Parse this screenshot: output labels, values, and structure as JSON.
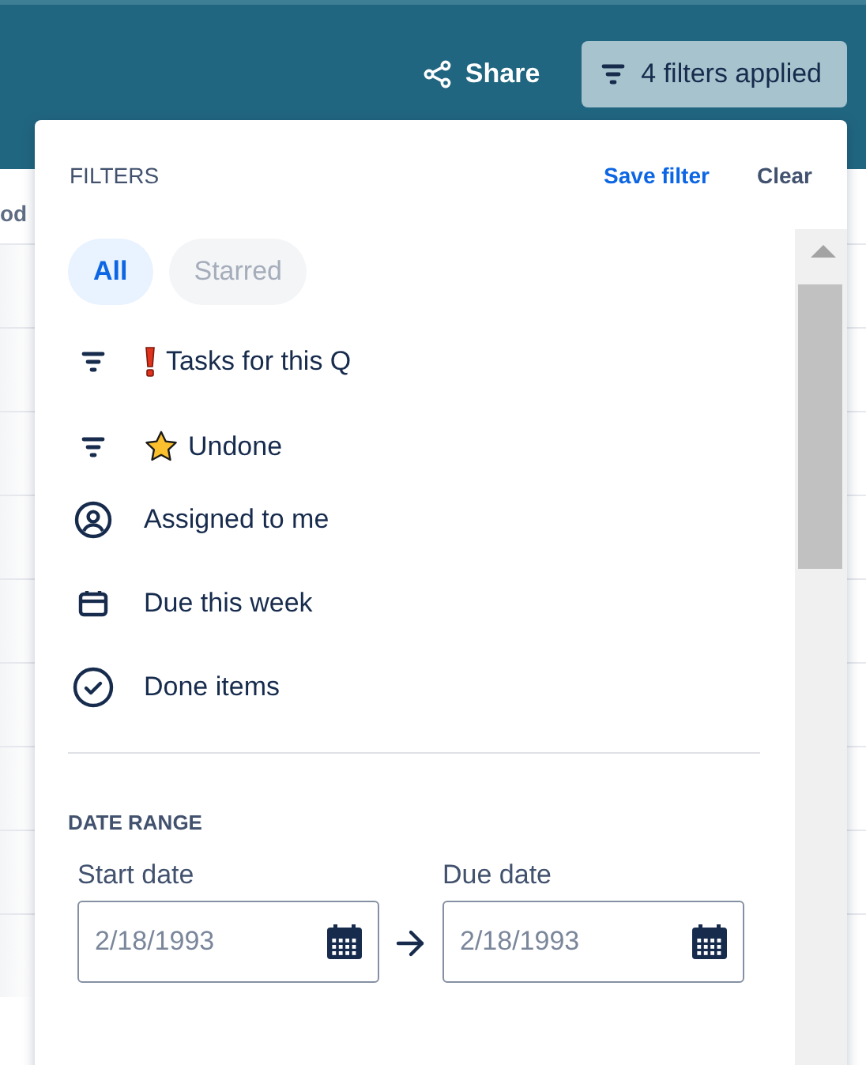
{
  "header": {
    "share_label": "Share",
    "filters_button": "4 filters applied"
  },
  "background": {
    "column_header": "od"
  },
  "filters_panel": {
    "title": "FILTERS",
    "save_link": "Save filter",
    "clear_link": "Clear",
    "tabs": [
      {
        "label": "All",
        "selected": true
      },
      {
        "label": "Starred",
        "selected": false
      }
    ],
    "items": [
      {
        "kind": "urgent",
        "label": "Tasks for this Q"
      },
      {
        "kind": "starred",
        "label": "Undone"
      },
      {
        "kind": "person",
        "label": "Assigned to me"
      },
      {
        "kind": "calendar",
        "label": "Due this week"
      },
      {
        "kind": "check",
        "label": "Done items"
      }
    ],
    "date_range": {
      "title": "DATE RANGE",
      "start": {
        "label": "Start date",
        "placeholder": "2/18/1993"
      },
      "due": {
        "label": "Due date",
        "placeholder": "2/18/1993"
      }
    }
  }
}
